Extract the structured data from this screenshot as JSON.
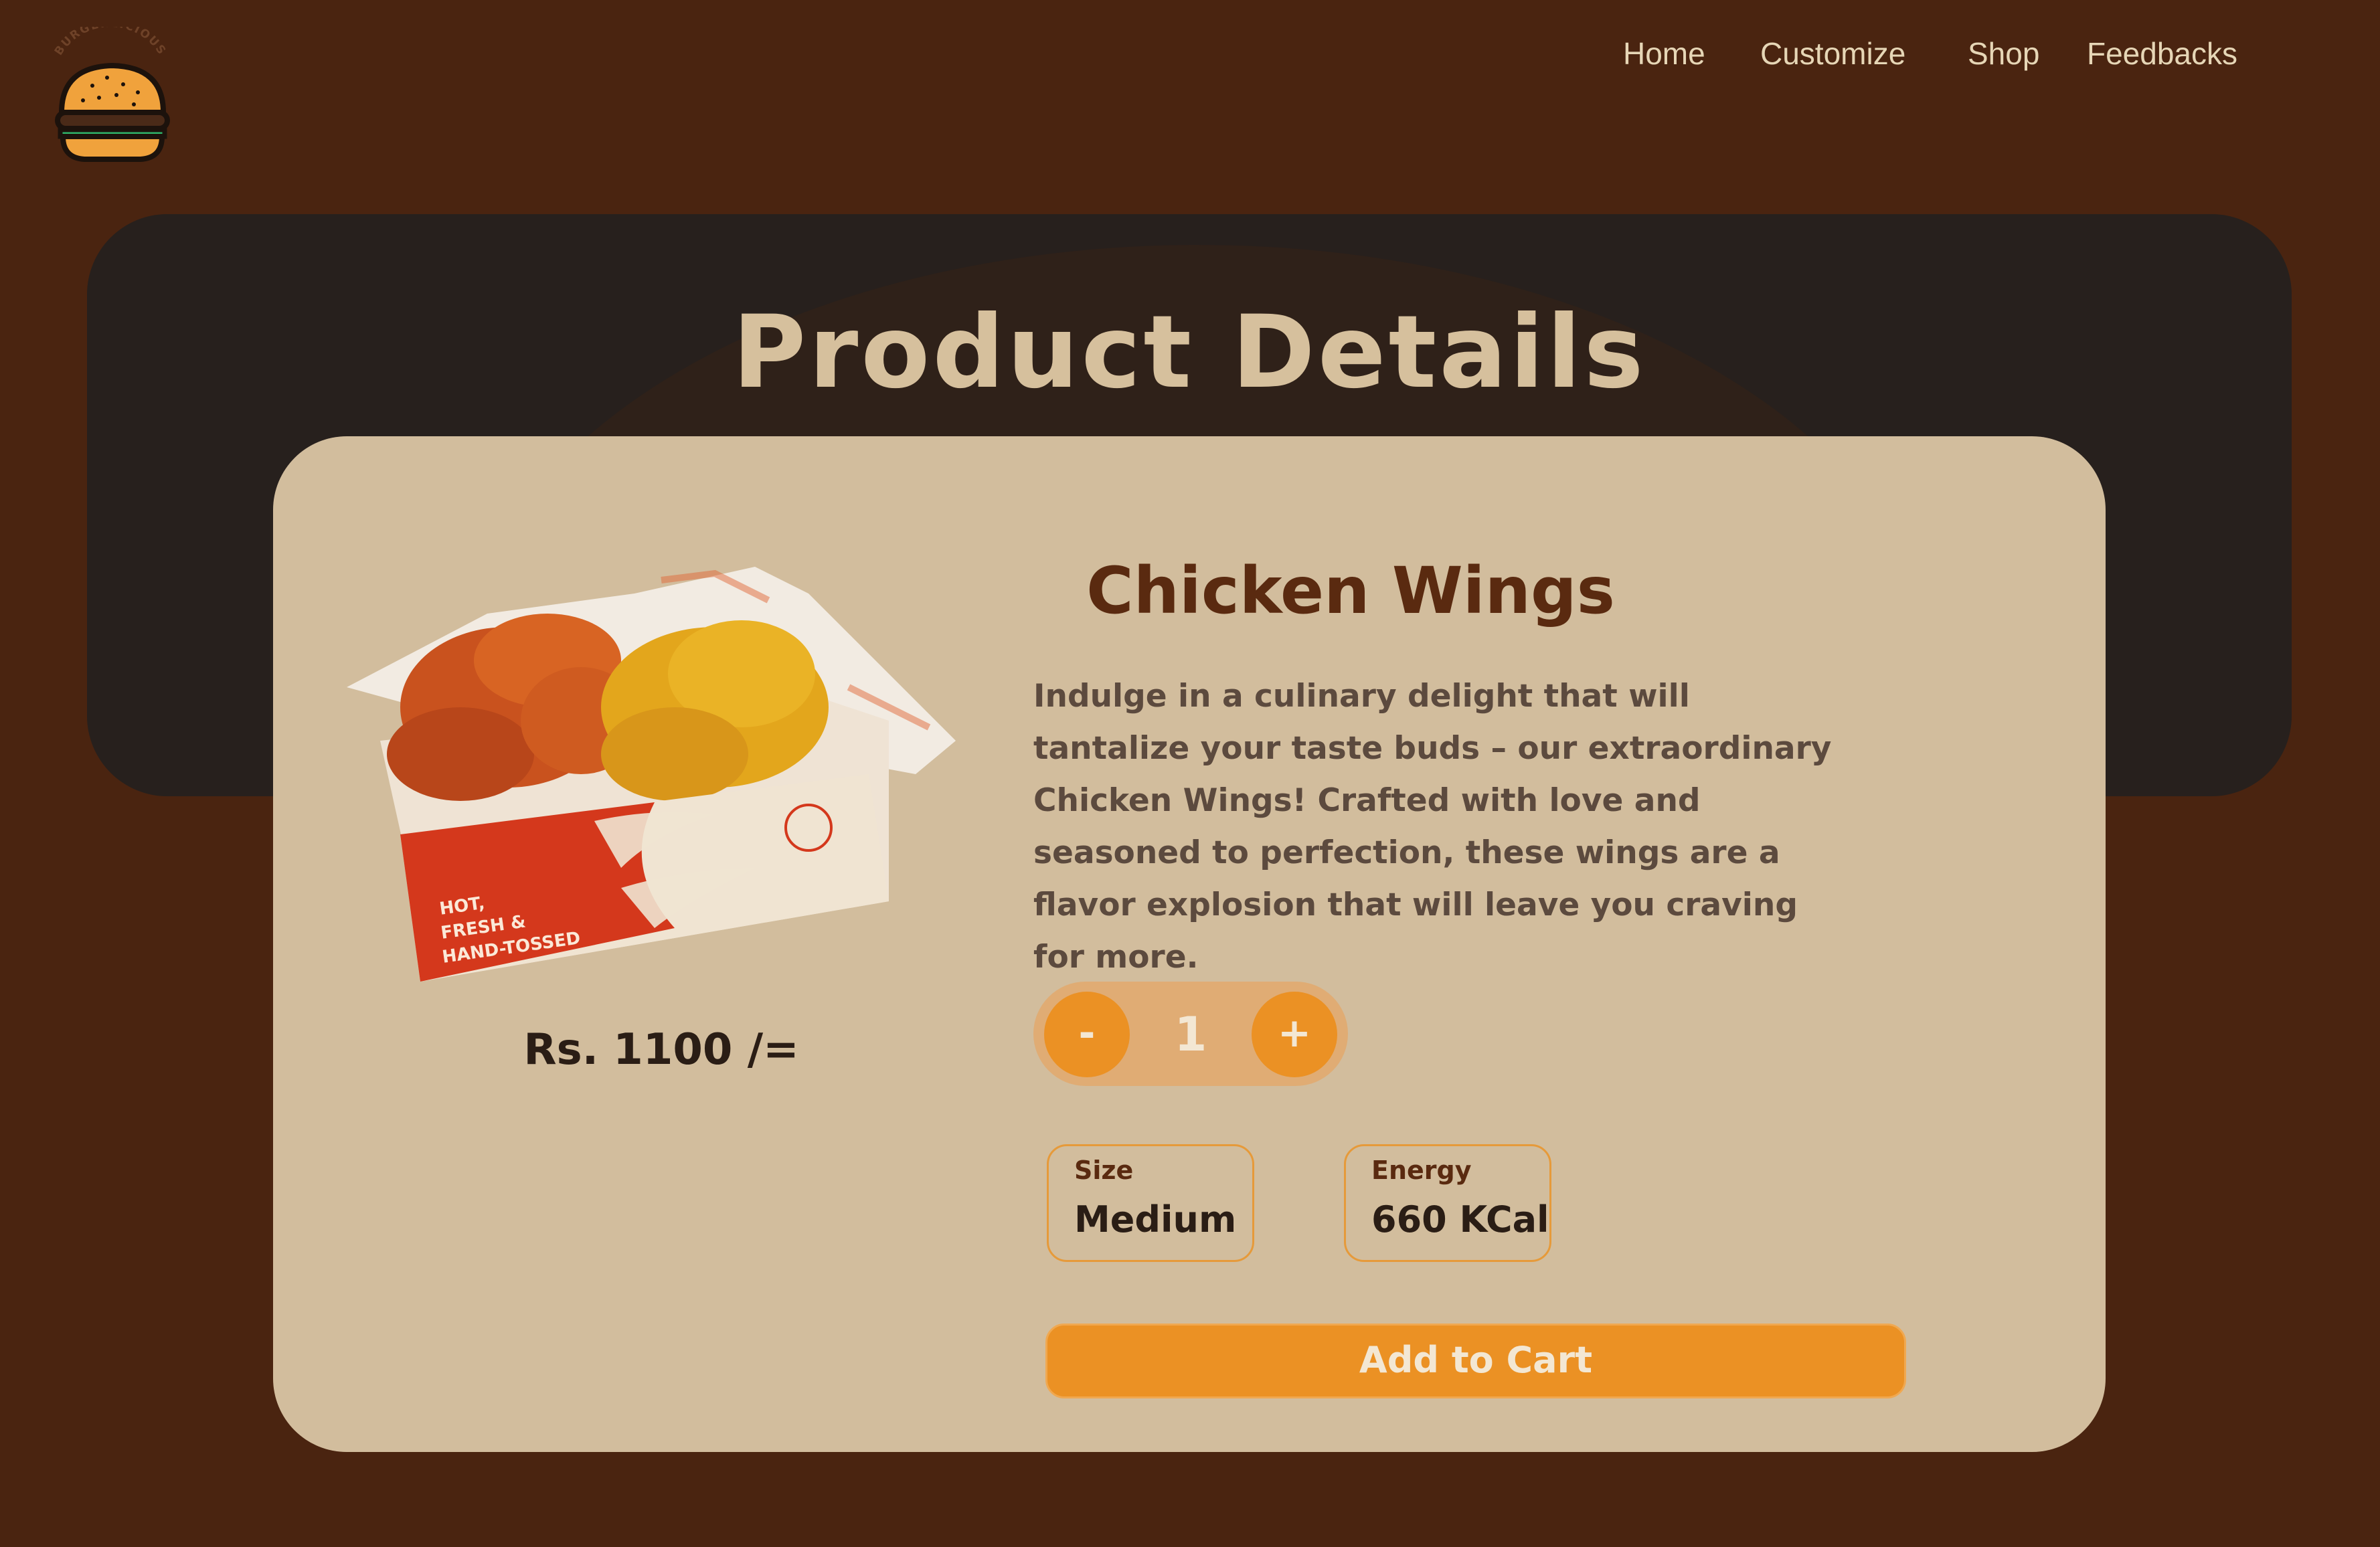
{
  "brand": {
    "logo_text": "BURGERLICIOUS"
  },
  "nav": {
    "links": [
      {
        "label": "Home"
      },
      {
        "label": "Customize"
      },
      {
        "label": "Shop"
      },
      {
        "label": "Feedbacks"
      }
    ]
  },
  "hero": {
    "title": "Product Details"
  },
  "product": {
    "name": "Chicken Wings",
    "description": "Indulge in a culinary delight that will tantalize your taste buds – our extraordinary Chicken Wings! Crafted with love and seasoned to perfection, these wings are a flavor explosion that will leave you craving for more.",
    "price": "Rs. 1100 /=",
    "image_box_text": [
      "HOT,",
      "FRESH &",
      "HAND-TOSSED"
    ],
    "quantity": {
      "decrement_label": "-",
      "value": "1",
      "increment_label": "+"
    },
    "attributes": [
      {
        "label": "Size",
        "value": "Medium"
      },
      {
        "label": "Energy",
        "value": "660 KCal"
      }
    ],
    "add_to_cart_label": "Add to Cart"
  },
  "colors": {
    "page_bg": "#4a2410",
    "hero_bg": "#27201d",
    "card_bg": "#d2bd9d",
    "accent": "#eb9124",
    "title_text": "#d6c09d",
    "heading_text": "#5a2a10"
  },
  "icons": {
    "logo": "burger-icon"
  }
}
